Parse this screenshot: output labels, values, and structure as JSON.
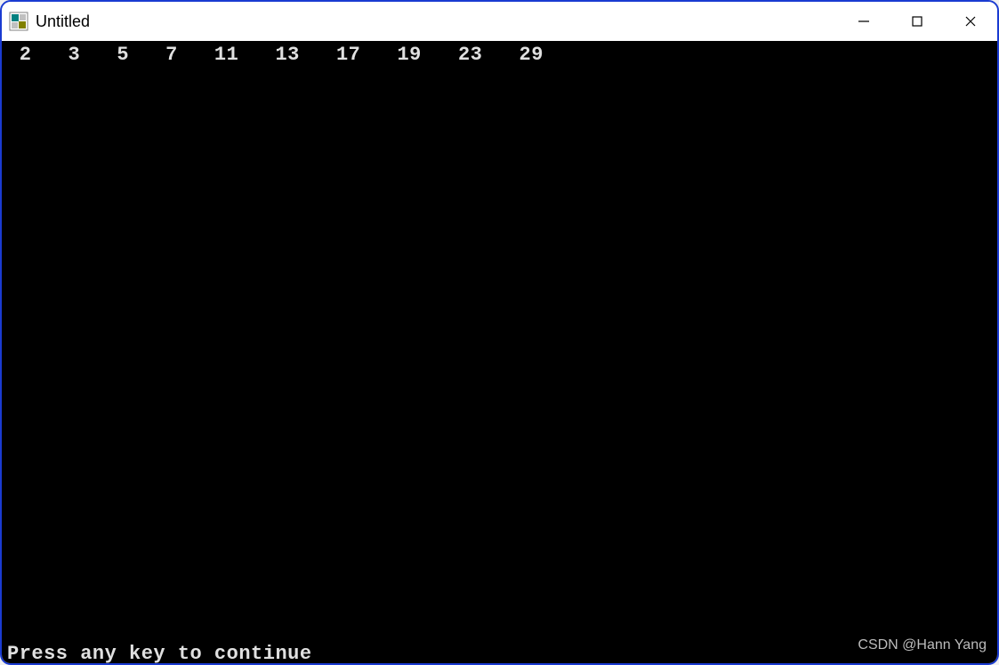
{
  "window": {
    "title": "Untitled"
  },
  "console": {
    "output": " 2   3   5   7   11   13   17   19   23   29",
    "prompt": "Press any key to continue"
  },
  "watermark": {
    "text": "CSDN @Hann Yang"
  }
}
